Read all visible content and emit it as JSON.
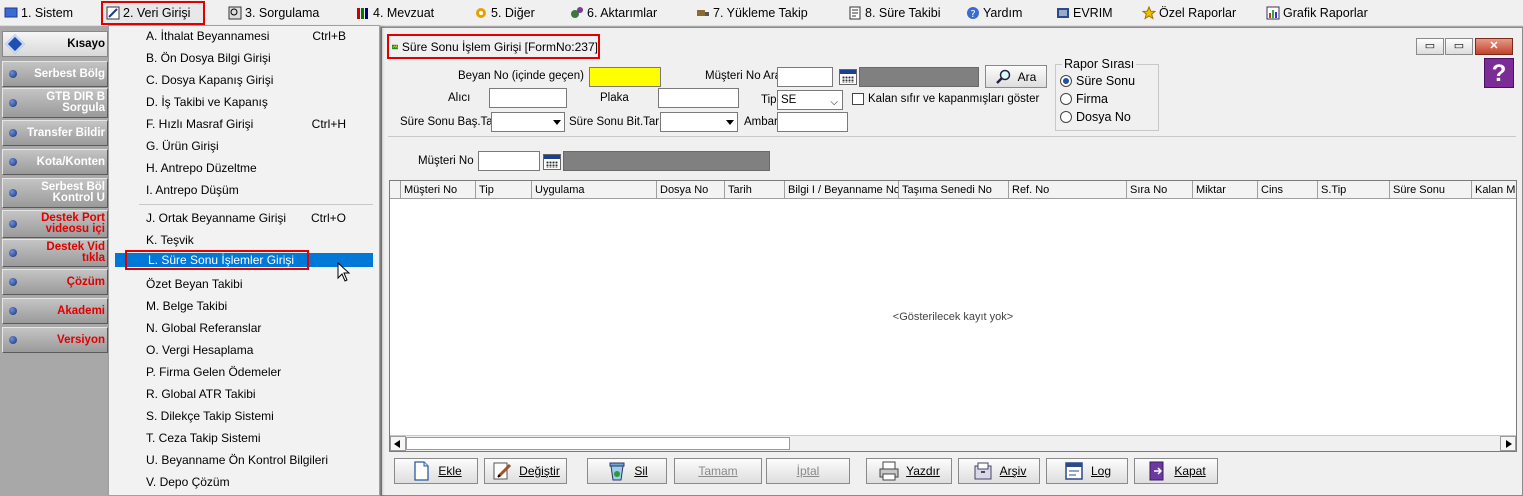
{
  "menubar": {
    "items": [
      {
        "label": "1.  Sistem"
      },
      {
        "label": "2.  Veri Girişi"
      },
      {
        "label": "3.  Sorgulama"
      },
      {
        "label": "4.  Mevzuat"
      },
      {
        "label": "5.  Diğer"
      },
      {
        "label": "6.  Aktarımlar"
      },
      {
        "label": "7.  Yükleme Takip"
      },
      {
        "label": "8. Süre Takibi"
      },
      {
        "label": "Yardım"
      },
      {
        "label": "EVRIM"
      },
      {
        "label": "Özel Raporlar"
      },
      {
        "label": "Grafik Raporlar"
      }
    ]
  },
  "sidebar": {
    "header": "Kısayo",
    "items": [
      {
        "label": "Serbest Bölg"
      },
      {
        "label1": "GTB DIR B",
        "label2": "Sorgula"
      },
      {
        "label": "Transfer Bildir"
      },
      {
        "label": "Kota/Konten"
      },
      {
        "label1": "Serbest Böl",
        "label2": "Kontrol U"
      },
      {
        "label1": "Destek Port",
        "label2": "videosu içi"
      },
      {
        "label1": "Destek Vid",
        "label2": "tıkla"
      },
      {
        "label": "Çözüm"
      },
      {
        "label": "Akademi"
      },
      {
        "label": "Versiyon"
      }
    ]
  },
  "dropdown": {
    "items": [
      {
        "label": "A.  İthalat Beyannamesi",
        "shortcut": "Ctrl+B"
      },
      {
        "label": "B.  Ön Dosya Bilgi Girişi",
        "shortcut": ""
      },
      {
        "label": "C.  Dosya Kapanış Girişi",
        "shortcut": ""
      },
      {
        "label": "D.  İş Takibi ve Kapanış",
        "shortcut": ""
      },
      {
        "label": "F.  Hızlı Masraf Girişi",
        "shortcut": "Ctrl+H"
      },
      {
        "label": "G.  Ürün Girişi",
        "shortcut": ""
      },
      {
        "label": "H.  Antrepo Düzeltme",
        "shortcut": ""
      },
      {
        "label": "I.   Antrepo Düşüm",
        "shortcut": ""
      },
      {
        "label": "J.  Ortak Beyanname Girişi",
        "shortcut": "Ctrl+O"
      },
      {
        "label": "K.  Teşvik",
        "shortcut": ""
      },
      {
        "label": "L.   Süre Sonu İşlemler Girişi",
        "shortcut": ""
      },
      {
        "label": "Özet Beyan Takibi",
        "shortcut": ""
      },
      {
        "label": "M.  Belge Takibi",
        "shortcut": ""
      },
      {
        "label": "N.  Global Referanslar",
        "shortcut": ""
      },
      {
        "label": "O. Vergi Hesaplama",
        "shortcut": ""
      },
      {
        "label": "P. Firma Gelen Ödemeler",
        "shortcut": ""
      },
      {
        "label": "R. Global ATR Takibi",
        "shortcut": ""
      },
      {
        "label": "S. Dilekçe Takip Sistemi",
        "shortcut": ""
      },
      {
        "label": "T. Ceza Takip Sistemi",
        "shortcut": ""
      },
      {
        "label": "U. Beyanname Ön Kontrol Bilgileri",
        "shortcut": ""
      },
      {
        "label": "V. Depo Çözüm",
        "shortcut": ""
      }
    ]
  },
  "window": {
    "title": "Süre Sonu İşlem Girişi [FormNo:237]",
    "help": "?",
    "controls": {
      "minimize": "▭",
      "restore": "▭",
      "close": "✕"
    }
  },
  "form": {
    "beyan_no_label": "Beyan No (içinde geçen)",
    "beyan_no_value": "",
    "musteri_no_ara_label": "Müşteri No Ara",
    "musteri_no_ara_value": "",
    "ara_button": "Ara",
    "alici_label": "Alıcı",
    "alici_value": "",
    "plaka_label": "Plaka",
    "plaka_value": "",
    "tip_label": "Tip",
    "tip_value": "SE",
    "kalan_checkbox": "Kalan sıfır ve kapanmışları göster",
    "sure_sonu_bas_label": "Süre Sonu Baş.Tar",
    "sure_sonu_bit_label": "Süre Sonu Bit.Tar",
    "ambar_label": "Ambar",
    "ambar_value": "",
    "musteri_no_label": "Müşteri No",
    "musteri_no_value": ""
  },
  "rapor": {
    "title": "Rapor Sırası",
    "options": [
      "Süre Sonu",
      "Firma",
      "Dosya No"
    ],
    "selected": "Süre Sonu"
  },
  "grid": {
    "columns": [
      "Müşteri No",
      "Tip",
      "Uygulama",
      "Dosya No",
      "Tarih",
      "Bilgi I / Beyanname No",
      "Taşıma Senedi No",
      "Ref. No",
      "Sıra No",
      "Miktar",
      "Cins",
      "S.Tip",
      "Süre Sonu",
      "Kalan Mi"
    ],
    "empty_text": "<Gösterilecek kayıt yok>"
  },
  "toolbar": {
    "ekle": "Ekle",
    "degistir": "Değiştir",
    "sil": "Sil",
    "tamam": "Tamam",
    "iptal": "İptal",
    "yazdir": "Yazdır",
    "arsiv": "Arşiv",
    "log": "Log",
    "kapat": "Kapat"
  },
  "colors": {
    "highlight_red": "#e00000",
    "selection_blue": "#0078d7",
    "input_yellow": "#ffff00",
    "sidebar_red_text": "#e00000"
  }
}
